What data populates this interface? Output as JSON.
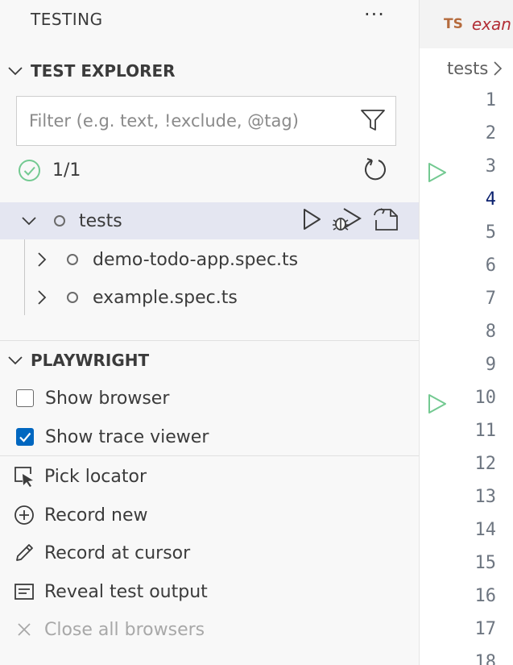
{
  "sidebar": {
    "title": "TESTING",
    "more_icon": "ellipsis-icon",
    "explorer": {
      "header": "TEST EXPLORER",
      "filter_placeholder": "Filter (e.g. text, !exclude, @tag)",
      "filter_value": "",
      "status": "1/1",
      "tree": [
        {
          "label": "tests",
          "expanded": true,
          "selected": true
        },
        {
          "label": "demo-todo-app.spec.ts",
          "expanded": false
        },
        {
          "label": "example.spec.ts",
          "expanded": false
        }
      ]
    },
    "playwright": {
      "header": "PLAYWRIGHT",
      "options": [
        {
          "label": "Show browser",
          "checked": false
        },
        {
          "label": "Show trace viewer",
          "checked": true
        }
      ],
      "actions": [
        {
          "label": "Pick locator",
          "icon": "pick-locator-icon",
          "enabled": true
        },
        {
          "label": "Record new",
          "icon": "circle-plus-icon",
          "enabled": true
        },
        {
          "label": "Record at cursor",
          "icon": "pencil-icon",
          "enabled": true
        },
        {
          "label": "Reveal test output",
          "icon": "output-icon",
          "enabled": true
        },
        {
          "label": "Close all browsers",
          "icon": "close-icon",
          "enabled": false
        }
      ]
    }
  },
  "editor": {
    "tab": {
      "lang_badge": "TS",
      "filename": "exan"
    },
    "breadcrumb": "tests",
    "line_numbers": [
      "1",
      "2",
      "3",
      "4",
      "5",
      "6",
      "7",
      "8",
      "9",
      "10",
      "11",
      "12",
      "13",
      "14",
      "15",
      "16",
      "17",
      "18"
    ],
    "active_line": "4",
    "run_gutter_lines": [
      "3",
      "10"
    ]
  },
  "colors": {
    "accent": "#0067c0",
    "pass": "#73c991",
    "selection": "#e4e6f1",
    "ts_badge": "#b56b3d",
    "tab_filename": "#b22d35"
  }
}
